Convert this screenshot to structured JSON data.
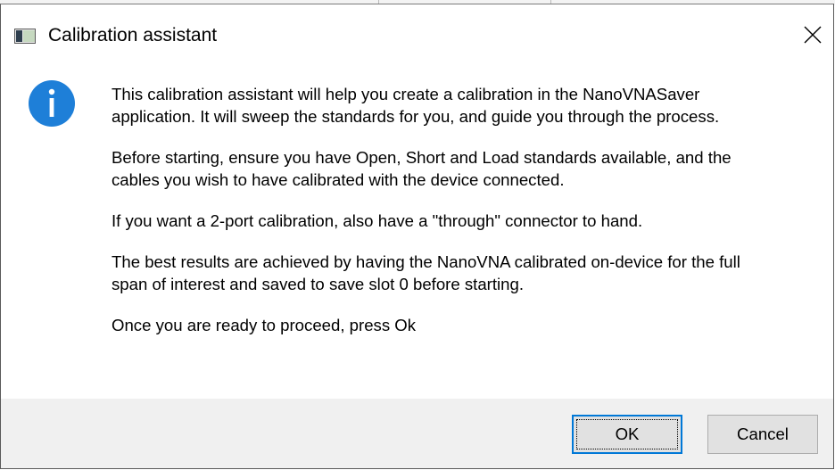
{
  "window": {
    "title": "Calibration assistant",
    "close_icon": "close-icon",
    "app_icon": "app-window-icon"
  },
  "message": {
    "icon": "info-icon",
    "paragraphs": [
      [
        "This calibration assistant will help you create a calibration in the NanoVNASaver",
        "application.  It will sweep the standards for you, and guide you through the process."
      ],
      [
        "Before starting, ensure you have Open, Short and Load standards available, and the",
        "cables you wish to have calibrated with the device connected."
      ],
      [
        "If you want a 2-port calibration, also have a \"through\" connector to hand."
      ],
      [
        "The best results are achieved by having the NanoVNA calibrated on-device for the full",
        "span of interest and saved to save slot 0 before starting."
      ],
      [
        "Once you are ready to proceed, press Ok"
      ]
    ]
  },
  "buttons": {
    "ok_label": "OK",
    "cancel_label": "Cancel"
  },
  "colors": {
    "info_blue": "#1e7fd8",
    "focus_border": "#0078d7",
    "button_bar": "#f0f0f0"
  }
}
